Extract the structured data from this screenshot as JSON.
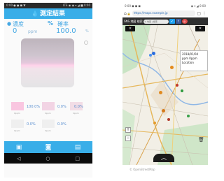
{
  "left_phone": {
    "status_bar": {
      "left": "0:00 ● ● ◼ ▼",
      "right": "LTE ◉ ◉ ▾ ◢ ■ 0:00"
    },
    "title": "測定結果",
    "labels": {
      "concentration": "濃度",
      "probability": "確率",
      "pct_symbol": "%"
    },
    "values": {
      "concentration": "0",
      "concentration_unit": "ppm",
      "probability": "100.0",
      "probability_unit": "%"
    },
    "grid": [
      {
        "percent": "100.0%",
        "label": "0ppm",
        "color": "#f9c6e0"
      },
      {
        "percent": "0.0%",
        "label": "0ppm",
        "color": "#f2d4e4"
      },
      {
        "percent": "0.0%",
        "label": "0ppm",
        "color": "#f2dde6"
      },
      {
        "percent": "0.0%",
        "label": "0ppm",
        "color": "#efefef"
      },
      {
        "percent": "0.0%",
        "label": "0ppm",
        "color": "#efefef"
      }
    ],
    "bottom_icons": [
      "image-icon",
      "camera-icon",
      "gallery-icon"
    ],
    "nav_icons": [
      "back-icon",
      "home-icon",
      "recents-icon"
    ]
  },
  "right_phone": {
    "status_bar": {
      "left": "0:00 ◼ ◼ ◼",
      "right": "◉ ▾ ◢ 0:00"
    },
    "url": "https://maps.example.jp",
    "toolbar": {
      "title": "SNS 地図 検索",
      "search_placeholder": "Q 地図 | 検索",
      "buttons": [
        "✔",
        "f",
        "◎"
      ]
    },
    "map_buttons": {
      "top_left": "×",
      "top_right": "✕"
    },
    "popup": {
      "date": "2018/01/04",
      "line2": "ppm 0ppm",
      "line3": "Location"
    },
    "zoom": {
      "in": "+",
      "out": "−"
    },
    "up_tab": "︿",
    "footer": "© OpenStreetMap"
  }
}
